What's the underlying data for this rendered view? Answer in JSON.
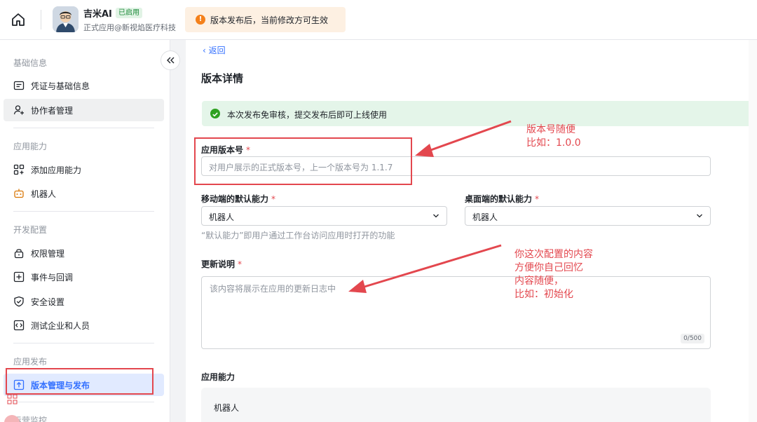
{
  "header": {
    "app_name": "吉米AI",
    "status_badge": "已启用",
    "app_subtitle": "正式应用@新视焰医疗科技",
    "notice": "版本发布后，当前修改方可生效",
    "colors": {
      "notice_bg": "#fdf0e2",
      "warn_icon": "#f4801a"
    }
  },
  "sidebar": {
    "sections": [
      {
        "title": "基础信息",
        "items": [
          {
            "label": "凭证与基础信息",
            "icon": "credential-card-icon"
          },
          {
            "label": "协作者管理",
            "icon": "user-plus-icon"
          }
        ]
      },
      {
        "title": "应用能力",
        "items": [
          {
            "label": "添加应用能力",
            "icon": "grid-add-icon"
          },
          {
            "label": "机器人",
            "icon": "robot-icon"
          }
        ]
      },
      {
        "title": "开发配置",
        "items": [
          {
            "label": "权限管理",
            "icon": "lock-icon"
          },
          {
            "label": "事件与回调",
            "icon": "event-callback-icon"
          },
          {
            "label": "安全设置",
            "icon": "shield-icon"
          },
          {
            "label": "测试企业和人员",
            "icon": "code-window-icon"
          }
        ]
      },
      {
        "title": "应用发布",
        "items": [
          {
            "label": "版本管理与发布",
            "icon": "upload-box-icon",
            "selected": true
          }
        ]
      },
      {
        "title": "运营监控",
        "items": []
      }
    ],
    "accent": "#3370ff"
  },
  "main": {
    "back": "返回",
    "title": "版本详情",
    "success_notice": "本次发布免审核，提交发布后即可上线使用",
    "version": {
      "label": "应用版本号",
      "required": "*",
      "placeholder": "对用户展示的正式版本号，上一个版本号为 1.1.7"
    },
    "mobile_default": {
      "label": "移动端的默认能力",
      "required": "*",
      "value": "机器人"
    },
    "desktop_default": {
      "label": "桌面端的默认能力",
      "required": "*",
      "value": "机器人"
    },
    "default_hint": "“默认能力”即用户通过工作台访问应用时打开的功能",
    "release_notes": {
      "label": "更新说明",
      "required": "*",
      "placeholder": "该内容将展示在应用的更新日志中",
      "counter": "0/500"
    },
    "capabilities": {
      "label": "应用能力",
      "item": "机器人"
    }
  },
  "annotations": {
    "version_note": [
      "版本号随便",
      "比如：1.0.0"
    ],
    "notes_note": [
      "你这次配置的内容",
      "方便你自己回忆",
      "内容随便，",
      "比如：初始化"
    ],
    "color": "#e3474e"
  }
}
